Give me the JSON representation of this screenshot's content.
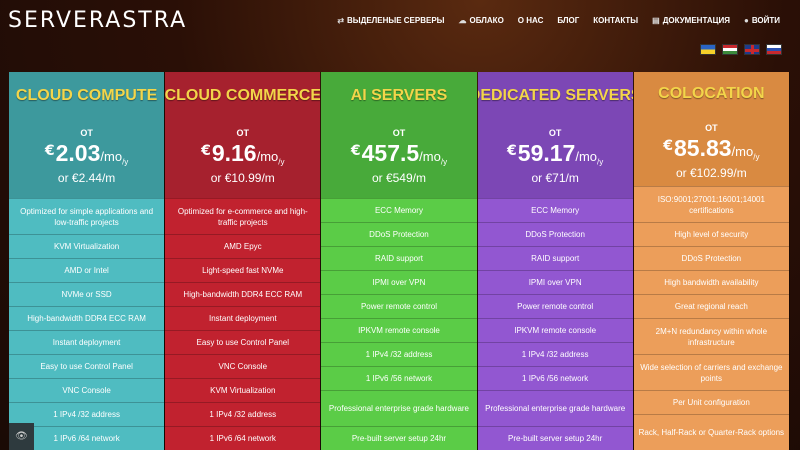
{
  "logo": "SERVERASTRA",
  "nav": [
    {
      "label": "ВЫДЕЛЕНЫЕ СЕРВЕРЫ",
      "icon": "servers-icon",
      "glyph": "⇄"
    },
    {
      "label": "ОБЛАКО",
      "icon": "cloud-icon",
      "glyph": "☁"
    },
    {
      "label": "О НАС",
      "icon": "",
      "glyph": ""
    },
    {
      "label": "БЛОГ",
      "icon": "",
      "glyph": ""
    },
    {
      "label": "КОНТАКТЫ",
      "icon": "",
      "glyph": ""
    },
    {
      "label": "ДОКУМЕНТАЦИЯ",
      "icon": "book-icon",
      "glyph": "▤"
    },
    {
      "label": "ВОЙТИ",
      "icon": "user-icon",
      "glyph": "●"
    }
  ],
  "flags": [
    "ua-flag-icon",
    "hu-flag-icon",
    "gb-flag-icon",
    "ru-flag-icon"
  ],
  "plans": [
    {
      "title": "CLOUD COMPUTE",
      "from": "ОТ",
      "currency": "€",
      "price": "2.03",
      "unit": "/mo",
      "unit_sub": "/y",
      "alt": "or €2.44/m",
      "features": [
        "Optimized for simple applications and low-traffic projects",
        "KVM Virtualization",
        "AMD or Intel",
        "NVMe or SSD",
        "High-bandwidth DDR4 ECC RAM",
        "Instant deployment",
        "Easy to use Control Panel",
        "VNC Console",
        "1 IPv4 /32 address",
        "1 IPv6 /64 network"
      ]
    },
    {
      "title": "CLOUD COMMERCE",
      "from": "ОТ",
      "currency": "€",
      "price": "9.16",
      "unit": "/mo",
      "unit_sub": "/y",
      "alt": "or €10.99/m",
      "features": [
        "Optimized for e-commerce and high-traffic projects",
        "AMD Epyc",
        "Light-speed fast NVMe",
        "High-bandwidth DDR4 ECC RAM",
        "Instant deployment",
        "Easy to use Control Panel",
        "VNC Console",
        "KVM Virtualization",
        "1 IPv4 /32 address",
        "1 IPv6 /64 network"
      ]
    },
    {
      "title": "AI SERVERS",
      "from": "ОТ",
      "currency": "€",
      "price": "457.5",
      "unit": "/mo",
      "unit_sub": "/y",
      "alt": "or €549/m",
      "features": [
        "ECC Memory",
        "DDoS Protection",
        "RAID support",
        "IPMI over VPN",
        "Power remote control",
        "IPKVM remote console",
        "1 IPv4 /32 address",
        "1 IPv6 /56 network",
        "Professional enterprise grade hardware",
        "Pre-built server setup 24hr"
      ]
    },
    {
      "title": "DEDICATED SERVERS",
      "from": "ОТ",
      "currency": "€",
      "price": "59.17",
      "unit": "/mo",
      "unit_sub": "/y",
      "alt": "or €71/m",
      "features": [
        "ECC Memory",
        "DDoS Protection",
        "RAID support",
        "IPMI over VPN",
        "Power remote control",
        "IPKVM remote console",
        "1 IPv4 /32 address",
        "1 IPv6 /56 network",
        "Professional enterprise grade hardware",
        "Pre-built server setup 24hr"
      ]
    },
    {
      "title": "COLOCATION",
      "from": "ОТ",
      "currency": "€",
      "price": "85.83",
      "unit": "/mo",
      "unit_sub": "/y",
      "alt": "or €102.99/m",
      "features": [
        "ISO:9001;27001;16001;14001 certifications",
        "High level of security",
        "DDoS Protection",
        "High bandwidth availability",
        "Great regional reach",
        "2M+N redundancy within whole infrastructure",
        "Wide selection of carriers and exchange points",
        "Per Unit configuration",
        "Rack, Half-Rack or Quarter-Rack options"
      ]
    }
  ]
}
